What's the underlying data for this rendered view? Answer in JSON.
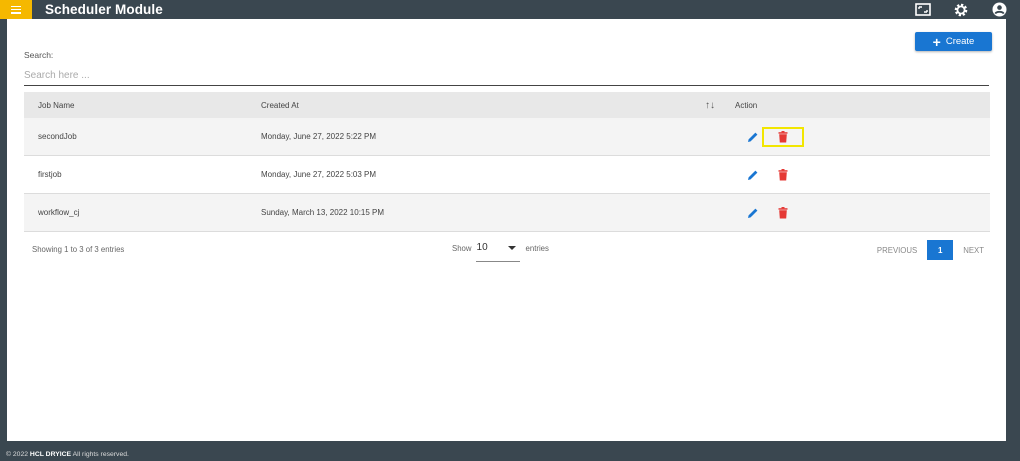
{
  "header": {
    "title": "Scheduler Module",
    "icons": [
      "menu-icon",
      "fullscreen-icon",
      "settings-icon",
      "account-icon"
    ],
    "accent": "#f5b800",
    "bg": "#3a4750"
  },
  "toolbar": {
    "create_label": "Create"
  },
  "search": {
    "label": "Search:",
    "placeholder": "Search here ...",
    "value": ""
  },
  "table": {
    "headers": {
      "name": "Job Name",
      "created": "Created At",
      "sort": "↑↓",
      "action": "Action"
    },
    "rows": [
      {
        "name": "secondJob",
        "created": "Monday, June 27, 2022 5:22 PM"
      },
      {
        "name": "firstjob",
        "created": "Monday, June 27, 2022 5:03 PM"
      },
      {
        "name": "workflow_cj",
        "created": "Sunday, March 13, 2022 10:15 PM"
      }
    ],
    "colors": {
      "edit": "#1976d2",
      "delete": "#e53935",
      "highlight": "#f2e600"
    }
  },
  "pagination": {
    "showing": "Showing 1 to 3 of 3 entries",
    "show_label": "Show",
    "page_size": "10",
    "entries_label": "entries",
    "prev": "PREVIOUS",
    "current": "1",
    "next": "NEXT"
  },
  "footer": {
    "copyright_prefix": "© 2022",
    "brand": "HCL DRYICE",
    "rights": "All rights reserved."
  }
}
